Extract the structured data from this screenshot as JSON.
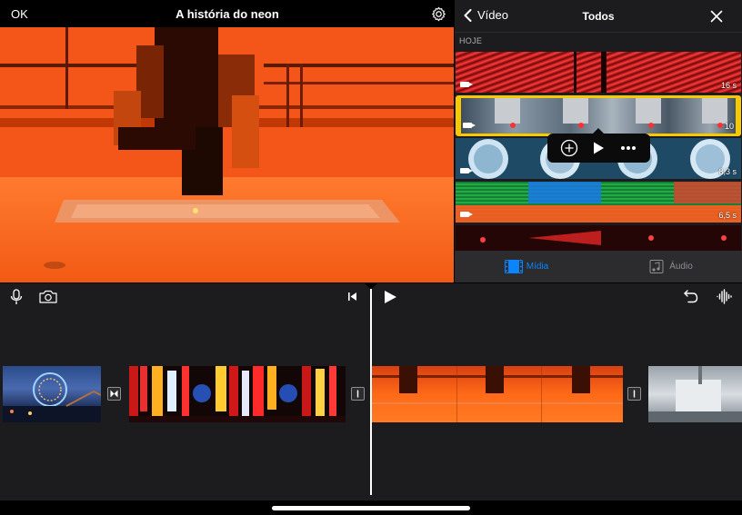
{
  "header": {
    "ok_label": "OK",
    "project_title": "A história do neon"
  },
  "browser": {
    "back_label": "Vídeo",
    "title": "Todos",
    "section_label": "HOJE",
    "clips": [
      {
        "duration": "16 s",
        "selected": false
      },
      {
        "duration": "10",
        "selected": true
      },
      {
        "duration": "8,3 s",
        "selected": false
      },
      {
        "duration": "6,5 s",
        "selected": false
      },
      {
        "duration": "",
        "selected": false
      }
    ],
    "tabs": {
      "media": "Mídia",
      "audio": "Áudio"
    }
  },
  "colors": {
    "accent_blue": "#0a84ff",
    "selection_yellow": "#f7c900",
    "panel_bg": "#1c1c1e"
  }
}
